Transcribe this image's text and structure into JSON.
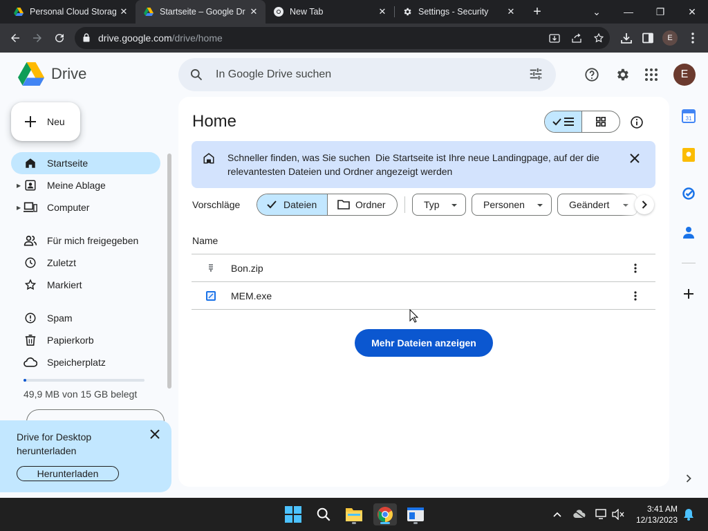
{
  "browser": {
    "tabs": [
      {
        "title": "Personal Cloud Storag",
        "favicon": "google-drive-icon",
        "active": false
      },
      {
        "title": "Startseite – Google Dr",
        "favicon": "google-drive-icon",
        "active": true
      },
      {
        "title": "New Tab",
        "favicon": "chrome-icon",
        "active": false
      },
      {
        "title": "Settings - Security",
        "favicon": "gear-icon",
        "active": false
      }
    ],
    "url_host": "drive.google.com",
    "url_path": "/drive/home",
    "profile_initial": "E"
  },
  "drive": {
    "product_name": "Drive",
    "search_placeholder": "In Google Drive suchen",
    "avatar_initial": "E",
    "new_button": "Neu",
    "nav": [
      {
        "label": "Startseite",
        "icon": "home-icon",
        "active": true
      },
      {
        "label": "Meine Ablage",
        "icon": "my-drive-icon",
        "expandable": true
      },
      {
        "label": "Computer",
        "icon": "computer-icon",
        "expandable": true
      },
      {
        "label": "Für mich freigegeben",
        "icon": "shared-icon"
      },
      {
        "label": "Zuletzt",
        "icon": "clock-icon"
      },
      {
        "label": "Markiert",
        "icon": "star-icon"
      },
      {
        "label": "Spam",
        "icon": "spam-icon"
      },
      {
        "label": "Papierkorb",
        "icon": "trash-icon"
      },
      {
        "label": "Speicherplatz",
        "icon": "cloud-icon"
      }
    ],
    "storage": {
      "text": "49,9 MB von 15 GB belegt",
      "fraction_used": 0.01
    },
    "promo": {
      "text": "Drive for Desktop herunterladen",
      "button": "Herunterladen"
    },
    "page_title": "Home",
    "banner": {
      "title": "Schneller finden, was Sie suchen",
      "body": "Die Startseite ist Ihre neue Landingpage, auf der die relevantesten Dateien und Ordner angezeigt werden"
    },
    "suggestions_label": "Vorschläge",
    "segments": [
      {
        "label": "Dateien",
        "active": true
      },
      {
        "label": "Ordner",
        "active": false
      }
    ],
    "filters": [
      "Typ",
      "Personen",
      "Geändert"
    ],
    "column_name": "Name",
    "files": [
      {
        "name": "Bon.zip",
        "icon": "zip-file-icon"
      },
      {
        "name": "MEM.exe",
        "icon": "exe-file-icon"
      }
    ],
    "more_files_button": "Mehr Dateien anzeigen"
  },
  "taskbar": {
    "time": "3:41 AM",
    "date": "12/13/2023"
  },
  "colors": {
    "accent_blue": "#0b57d0",
    "selected_blue": "#c2e7ff",
    "banner_blue": "#d3e3fd",
    "page_bg": "#f8fafd"
  }
}
